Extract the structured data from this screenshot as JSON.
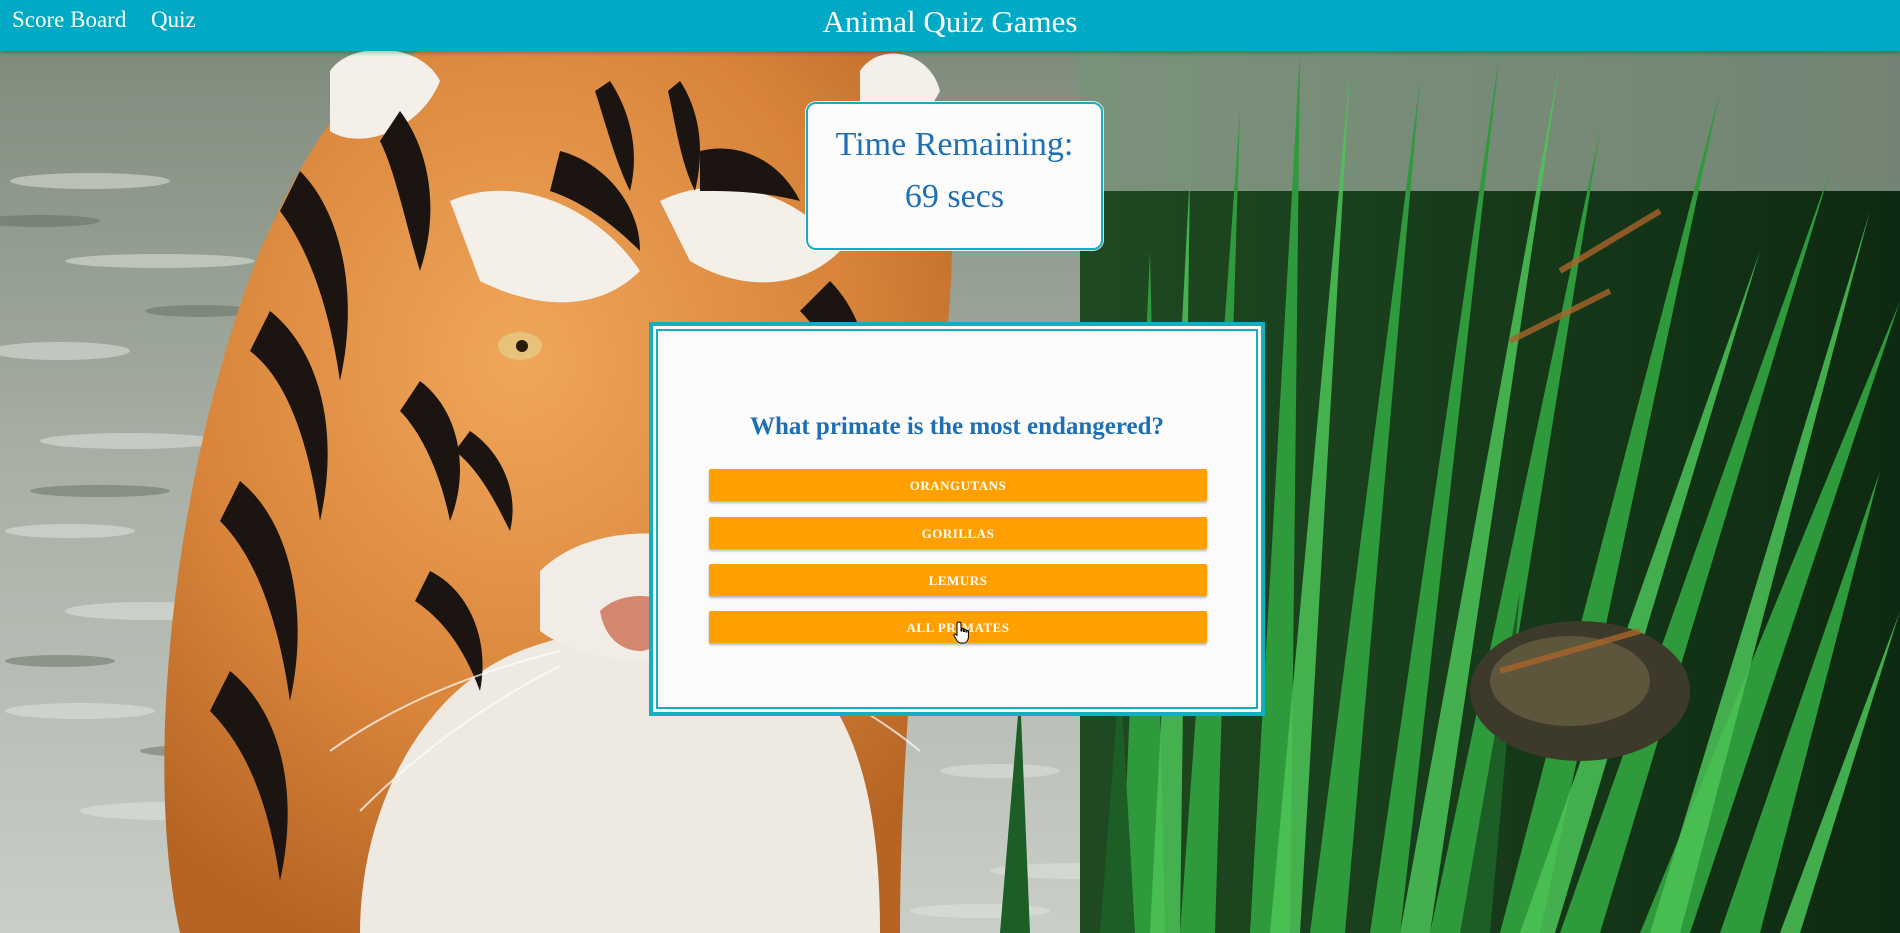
{
  "nav": {
    "score_board_label": "Score Board",
    "quiz_label": "Quiz",
    "title": "Animal Quiz Games"
  },
  "timer": {
    "label": "Time Remaining:",
    "value": "69 secs"
  },
  "quiz": {
    "question": "What primate is the most endangered?",
    "answers": [
      "ORANGUTANS",
      "GORILLAS",
      "LEMURS",
      "ALL PRIMATES"
    ]
  },
  "colors": {
    "nav_bg": "#00a9c4",
    "accent_border": "#13aec0",
    "text_blue": "#1f6fb5",
    "button_orange": "#ffa000"
  },
  "background": {
    "subject": "tiger-in-water-with-reeds"
  }
}
